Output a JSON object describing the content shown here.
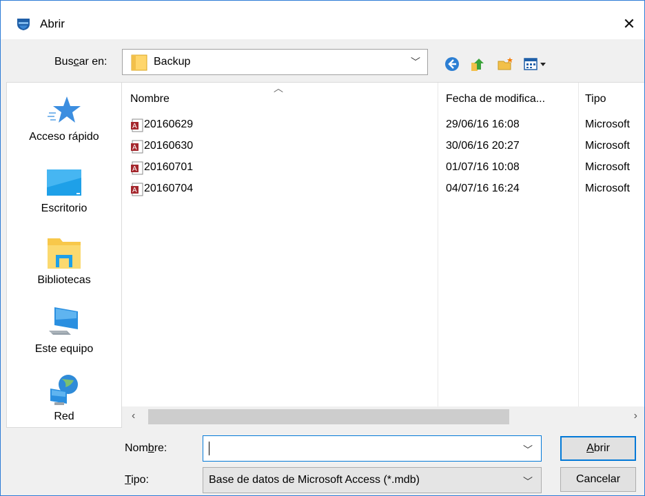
{
  "window": {
    "title": "Abrir",
    "close_label": "✕"
  },
  "lookin": {
    "label_pre": "Bus",
    "label_key": "c",
    "label_post": "ar en:",
    "value": "Backup"
  },
  "toolbar": {
    "icons": [
      "back-icon",
      "up-folder-icon",
      "new-folder-icon",
      "view-menu-icon"
    ]
  },
  "places": [
    {
      "label": "Acceso rápido",
      "icon": "star-icon"
    },
    {
      "label": "Escritorio",
      "icon": "desktop-icon"
    },
    {
      "label": "Bibliotecas",
      "icon": "libraries-icon"
    },
    {
      "label": "Este equipo",
      "icon": "computer-icon"
    },
    {
      "label": "Red",
      "icon": "network-icon"
    }
  ],
  "columns": {
    "name": "Nombre",
    "date": "Fecha de modifica...",
    "type": "Tipo"
  },
  "files": [
    {
      "name": "20160629",
      "date": "29/06/16 16:08",
      "type": "Microsoft"
    },
    {
      "name": "20160630",
      "date": "30/06/16 20:27",
      "type": "Microsoft"
    },
    {
      "name": "20160701",
      "date": "01/07/16 10:08",
      "type": "Microsoft"
    },
    {
      "name": "20160704",
      "date": "04/07/16 16:24",
      "type": "Microsoft"
    }
  ],
  "filename": {
    "label_pre": "Nom",
    "label_key": "b",
    "label_post": "re:",
    "value": ""
  },
  "filetype": {
    "label_key": "T",
    "label_post": "ipo:",
    "value": "Base de datos de Microsoft Access (*.mdb)"
  },
  "buttons": {
    "open_key": "A",
    "open_post": "brir",
    "cancel": "Cancelar"
  },
  "colors": {
    "accent": "#0078d7",
    "window_border": "#2b7bd6",
    "access_file": "#a4262c"
  }
}
